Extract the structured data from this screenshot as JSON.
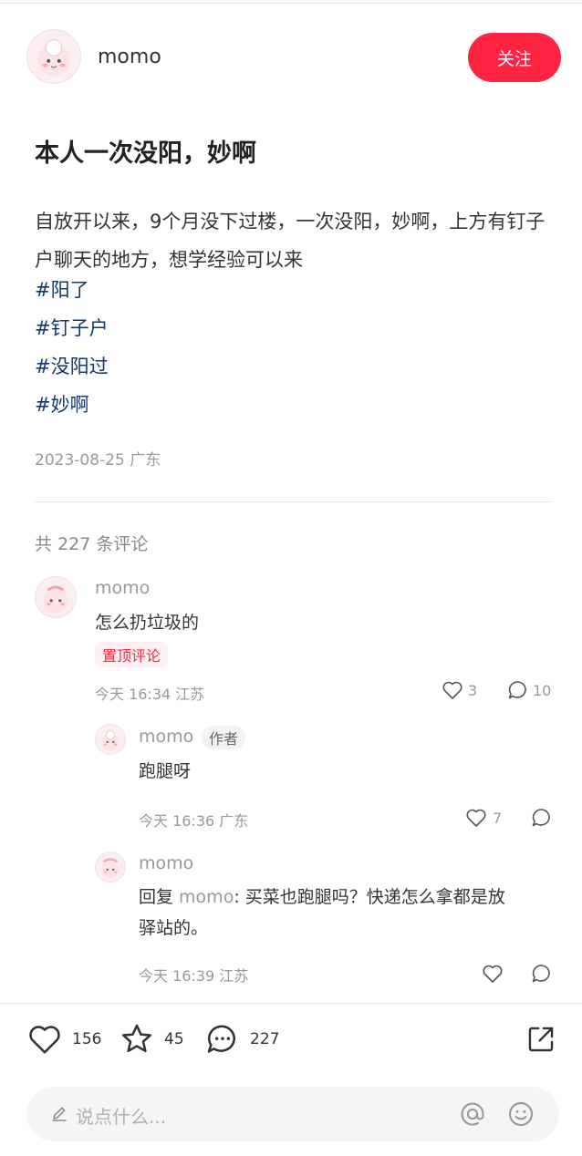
{
  "post": {
    "author": "momo",
    "follow_label": "关注",
    "title": "本人一次没阳，妙啊",
    "body": "自放开以来，9个月没下过楼，一次没阳，妙啊，上方有钉子户聊天的地方，想学经验可以来",
    "tags": [
      "#阳了",
      "#钉子户",
      "#没阳过",
      "#妙啊"
    ],
    "meta": "2023-08-25 广东"
  },
  "comments_header": "共 227 条评论",
  "comments": [
    {
      "name": "momo",
      "text": "怎么扔垃圾的",
      "badge": "置顶评论",
      "meta": "今天 16:34  江苏",
      "likes": "3",
      "replies": "10"
    },
    {
      "name": "momo",
      "author_badge": "作者",
      "text": "跑腿呀",
      "meta": "今天 16:36  广东",
      "likes": "7"
    },
    {
      "name": "momo",
      "reply_prefix": "回复 ",
      "reply_to": "momo",
      "text_line1": ": 买菜也跑腿吗？快递怎么拿都是放",
      "text_line2": "驿站的。",
      "meta": "今天 16:39  江苏"
    }
  ],
  "bottom": {
    "likes": "156",
    "stars": "45",
    "comments": "227",
    "input_placeholder": "说点什么..."
  },
  "colors": {
    "accent": "#ff2442",
    "tag": "#13386c",
    "muted": "#999999"
  },
  "icons": [
    "heart-icon",
    "comment-icon",
    "star-icon",
    "share-icon",
    "pencil-icon",
    "at-icon",
    "emoji-icon"
  ]
}
